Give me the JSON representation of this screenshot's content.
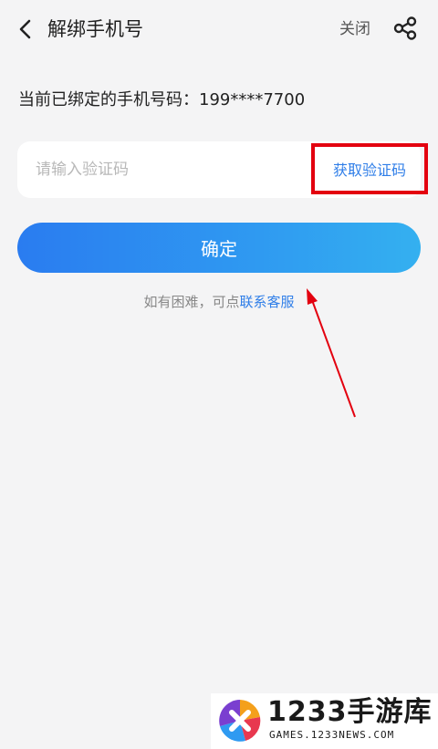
{
  "header": {
    "title": "解绑手机号",
    "close_label": "关闭"
  },
  "bound_phone": {
    "text": "当前已绑定的手机号码：199****7700"
  },
  "verification": {
    "placeholder": "请输入验证码",
    "value": "",
    "get_code_label": "获取验证码"
  },
  "confirm_label": "确定",
  "help": {
    "prefix": "如有困难，可点",
    "link": "联系客服"
  },
  "annotation": {
    "highlight_color": "#e3000f",
    "arrow_color": "#e3000f"
  },
  "watermark": {
    "brand": "1233手游库",
    "site": "GAMES.1233NEWS.COM"
  },
  "colors": {
    "accent": "#2f7ee8",
    "background": "#f4f4f5"
  }
}
